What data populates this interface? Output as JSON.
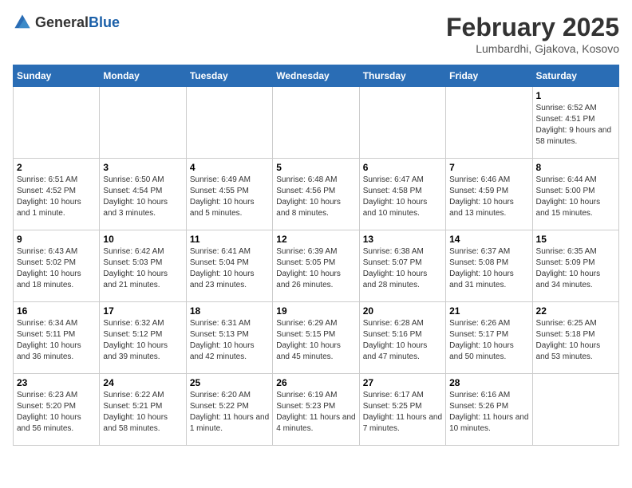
{
  "header": {
    "logo": {
      "general": "General",
      "blue": "Blue"
    },
    "title": "February 2025",
    "subtitle": "Lumbardhi, Gjakova, Kosovo"
  },
  "calendar": {
    "weekdays": [
      "Sunday",
      "Monday",
      "Tuesday",
      "Wednesday",
      "Thursday",
      "Friday",
      "Saturday"
    ],
    "weeks": [
      [
        {
          "day": "",
          "empty": true
        },
        {
          "day": "",
          "empty": true
        },
        {
          "day": "",
          "empty": true
        },
        {
          "day": "",
          "empty": true
        },
        {
          "day": "",
          "empty": true
        },
        {
          "day": "",
          "empty": true
        },
        {
          "day": "1",
          "sunrise": "6:52 AM",
          "sunset": "4:51 PM",
          "daylight": "Daylight: 9 hours and 58 minutes."
        }
      ],
      [
        {
          "day": "2",
          "sunrise": "6:51 AM",
          "sunset": "4:52 PM",
          "daylight": "Daylight: 10 hours and 1 minute."
        },
        {
          "day": "3",
          "sunrise": "6:50 AM",
          "sunset": "4:54 PM",
          "daylight": "Daylight: 10 hours and 3 minutes."
        },
        {
          "day": "4",
          "sunrise": "6:49 AM",
          "sunset": "4:55 PM",
          "daylight": "Daylight: 10 hours and 5 minutes."
        },
        {
          "day": "5",
          "sunrise": "6:48 AM",
          "sunset": "4:56 PM",
          "daylight": "Daylight: 10 hours and 8 minutes."
        },
        {
          "day": "6",
          "sunrise": "6:47 AM",
          "sunset": "4:58 PM",
          "daylight": "Daylight: 10 hours and 10 minutes."
        },
        {
          "day": "7",
          "sunrise": "6:46 AM",
          "sunset": "4:59 PM",
          "daylight": "Daylight: 10 hours and 13 minutes."
        },
        {
          "day": "8",
          "sunrise": "6:44 AM",
          "sunset": "5:00 PM",
          "daylight": "Daylight: 10 hours and 15 minutes."
        }
      ],
      [
        {
          "day": "9",
          "sunrise": "6:43 AM",
          "sunset": "5:02 PM",
          "daylight": "Daylight: 10 hours and 18 minutes."
        },
        {
          "day": "10",
          "sunrise": "6:42 AM",
          "sunset": "5:03 PM",
          "daylight": "Daylight: 10 hours and 21 minutes."
        },
        {
          "day": "11",
          "sunrise": "6:41 AM",
          "sunset": "5:04 PM",
          "daylight": "Daylight: 10 hours and 23 minutes."
        },
        {
          "day": "12",
          "sunrise": "6:39 AM",
          "sunset": "5:05 PM",
          "daylight": "Daylight: 10 hours and 26 minutes."
        },
        {
          "day": "13",
          "sunrise": "6:38 AM",
          "sunset": "5:07 PM",
          "daylight": "Daylight: 10 hours and 28 minutes."
        },
        {
          "day": "14",
          "sunrise": "6:37 AM",
          "sunset": "5:08 PM",
          "daylight": "Daylight: 10 hours and 31 minutes."
        },
        {
          "day": "15",
          "sunrise": "6:35 AM",
          "sunset": "5:09 PM",
          "daylight": "Daylight: 10 hours and 34 minutes."
        }
      ],
      [
        {
          "day": "16",
          "sunrise": "6:34 AM",
          "sunset": "5:11 PM",
          "daylight": "Daylight: 10 hours and 36 minutes."
        },
        {
          "day": "17",
          "sunrise": "6:32 AM",
          "sunset": "5:12 PM",
          "daylight": "Daylight: 10 hours and 39 minutes."
        },
        {
          "day": "18",
          "sunrise": "6:31 AM",
          "sunset": "5:13 PM",
          "daylight": "Daylight: 10 hours and 42 minutes."
        },
        {
          "day": "19",
          "sunrise": "6:29 AM",
          "sunset": "5:15 PM",
          "daylight": "Daylight: 10 hours and 45 minutes."
        },
        {
          "day": "20",
          "sunrise": "6:28 AM",
          "sunset": "5:16 PM",
          "daylight": "Daylight: 10 hours and 47 minutes."
        },
        {
          "day": "21",
          "sunrise": "6:26 AM",
          "sunset": "5:17 PM",
          "daylight": "Daylight: 10 hours and 50 minutes."
        },
        {
          "day": "22",
          "sunrise": "6:25 AM",
          "sunset": "5:18 PM",
          "daylight": "Daylight: 10 hours and 53 minutes."
        }
      ],
      [
        {
          "day": "23",
          "sunrise": "6:23 AM",
          "sunset": "5:20 PM",
          "daylight": "Daylight: 10 hours and 56 minutes."
        },
        {
          "day": "24",
          "sunrise": "6:22 AM",
          "sunset": "5:21 PM",
          "daylight": "Daylight: 10 hours and 58 minutes."
        },
        {
          "day": "25",
          "sunrise": "6:20 AM",
          "sunset": "5:22 PM",
          "daylight": "Daylight: 11 hours and 1 minute."
        },
        {
          "day": "26",
          "sunrise": "6:19 AM",
          "sunset": "5:23 PM",
          "daylight": "Daylight: 11 hours and 4 minutes."
        },
        {
          "day": "27",
          "sunrise": "6:17 AM",
          "sunset": "5:25 PM",
          "daylight": "Daylight: 11 hours and 7 minutes."
        },
        {
          "day": "28",
          "sunrise": "6:16 AM",
          "sunset": "5:26 PM",
          "daylight": "Daylight: 11 hours and 10 minutes."
        },
        {
          "day": "",
          "empty": true
        }
      ]
    ]
  }
}
